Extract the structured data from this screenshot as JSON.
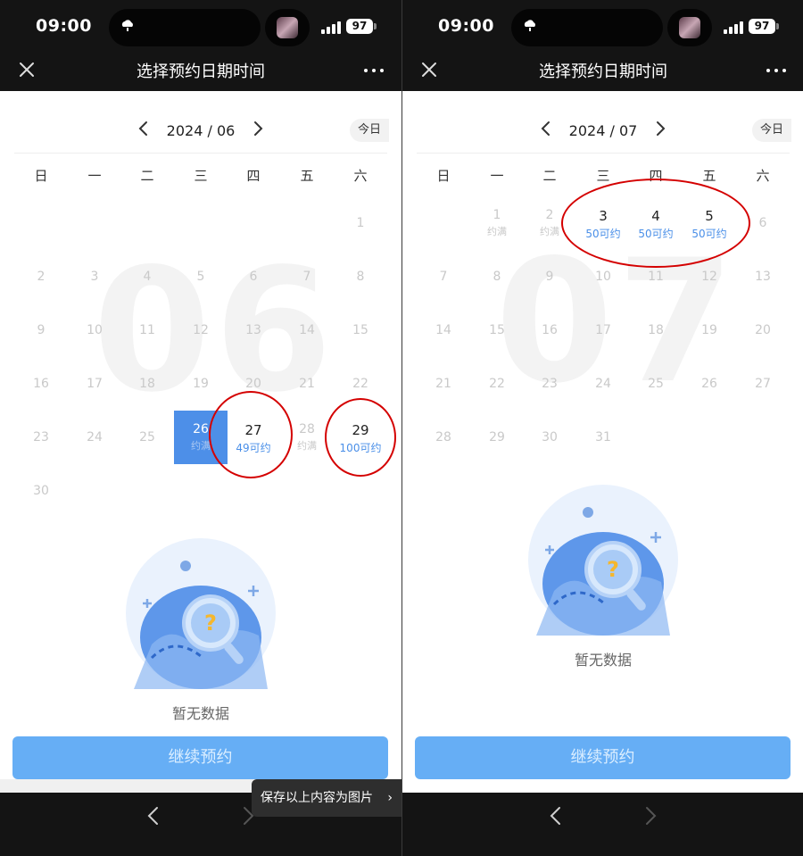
{
  "status": {
    "time": "09:00",
    "battery": "97"
  },
  "nav": {
    "title": "选择预约日期时间"
  },
  "weekdays": [
    "日",
    "一",
    "二",
    "三",
    "四",
    "五",
    "六"
  ],
  "today_label": "今日",
  "left": {
    "month": "2024 / 06",
    "watermark": "06",
    "days": [
      {
        "n": "1"
      },
      {
        "n": "2"
      },
      {
        "n": "3"
      },
      {
        "n": "4"
      },
      {
        "n": "5"
      },
      {
        "n": "6"
      },
      {
        "n": "7"
      },
      {
        "n": "8"
      },
      {
        "n": "9"
      },
      {
        "n": "10"
      },
      {
        "n": "11"
      },
      {
        "n": "12"
      },
      {
        "n": "13"
      },
      {
        "n": "14"
      },
      {
        "n": "15"
      },
      {
        "n": "16"
      },
      {
        "n": "17"
      },
      {
        "n": "18"
      },
      {
        "n": "19"
      },
      {
        "n": "20"
      },
      {
        "n": "21"
      },
      {
        "n": "22"
      },
      {
        "n": "23"
      },
      {
        "n": "24"
      },
      {
        "n": "25"
      },
      {
        "n": "26",
        "s": "约满",
        "selected": true
      },
      {
        "n": "27",
        "s": "49可约",
        "avail": true
      },
      {
        "n": "28",
        "s": "约满"
      },
      {
        "n": "29",
        "s": "100可约",
        "avail": true
      },
      {
        "n": "30"
      }
    ],
    "first_weekday": 6,
    "empty_text": "暂无数据",
    "button": "继续预约",
    "toast": "保存以上内容为图片"
  },
  "right": {
    "month": "2024 / 07",
    "watermark": "07",
    "days": [
      {
        "n": "1",
        "s": "约满"
      },
      {
        "n": "2",
        "s": "约满"
      },
      {
        "n": "3",
        "s": "50可约",
        "avail": true
      },
      {
        "n": "4",
        "s": "50可约",
        "avail": true
      },
      {
        "n": "5",
        "s": "50可约",
        "avail": true
      },
      {
        "n": "6"
      },
      {
        "n": "7"
      },
      {
        "n": "8"
      },
      {
        "n": "9"
      },
      {
        "n": "10"
      },
      {
        "n": "11"
      },
      {
        "n": "12"
      },
      {
        "n": "13"
      },
      {
        "n": "14"
      },
      {
        "n": "15"
      },
      {
        "n": "16"
      },
      {
        "n": "17"
      },
      {
        "n": "18"
      },
      {
        "n": "19"
      },
      {
        "n": "20"
      },
      {
        "n": "21"
      },
      {
        "n": "22"
      },
      {
        "n": "23"
      },
      {
        "n": "24"
      },
      {
        "n": "25"
      },
      {
        "n": "26"
      },
      {
        "n": "27"
      },
      {
        "n": "28"
      },
      {
        "n": "29"
      },
      {
        "n": "30"
      },
      {
        "n": "31"
      }
    ],
    "first_weekday": 1,
    "empty_text": "暂无数据",
    "button": "继续预约"
  },
  "colors": {
    "accent": "#4d8fe8",
    "button": "#66aef5",
    "annotation": "#d40000"
  }
}
